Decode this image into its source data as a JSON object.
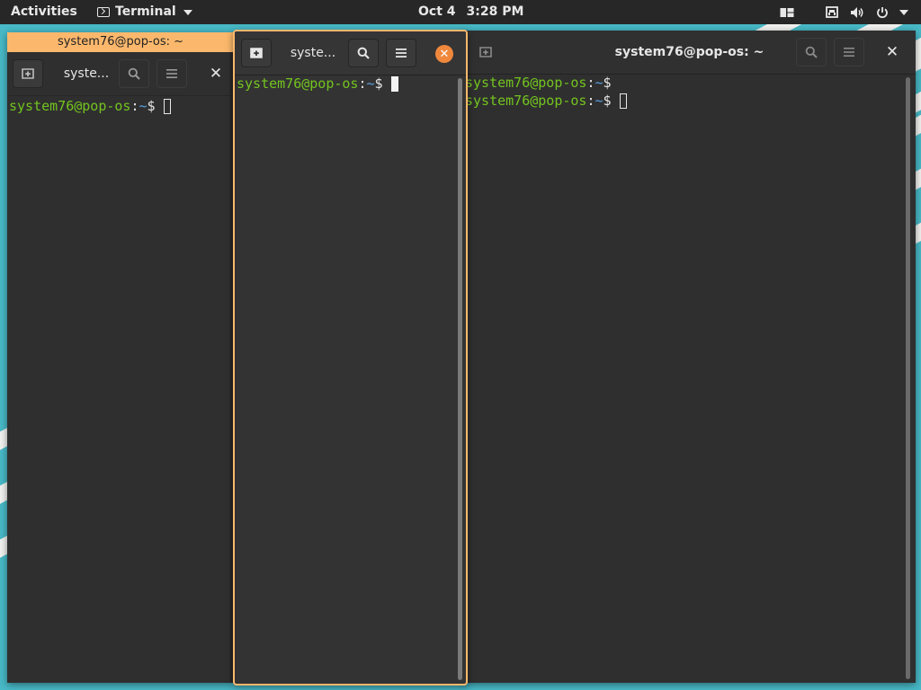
{
  "topbar": {
    "activities_label": "Activities",
    "app_menu_label": "Terminal",
    "date": "Oct 4",
    "time": "3:28 PM"
  },
  "prompt": {
    "user_host": "system76@pop-os",
    "colon": ":",
    "path": "~",
    "symbol": "$"
  },
  "windows": {
    "left": {
      "window_title": "system76@pop-os: ~",
      "tab_title": "syste..."
    },
    "middle": {
      "tab_title": "syste..."
    },
    "right": {
      "tab_title": "system76@pop-os: ~"
    }
  },
  "colors": {
    "focus_accent": "#fbb86c",
    "close_button": "#f0883c",
    "prompt_user": "#73c41f",
    "prompt_path": "#5aa0e0",
    "wallpaper": "#48b9c7"
  },
  "icons": {
    "new_tab": "new-tab-icon",
    "search": "search-icon",
    "menu": "hamburger-menu-icon",
    "close": "close-icon"
  }
}
